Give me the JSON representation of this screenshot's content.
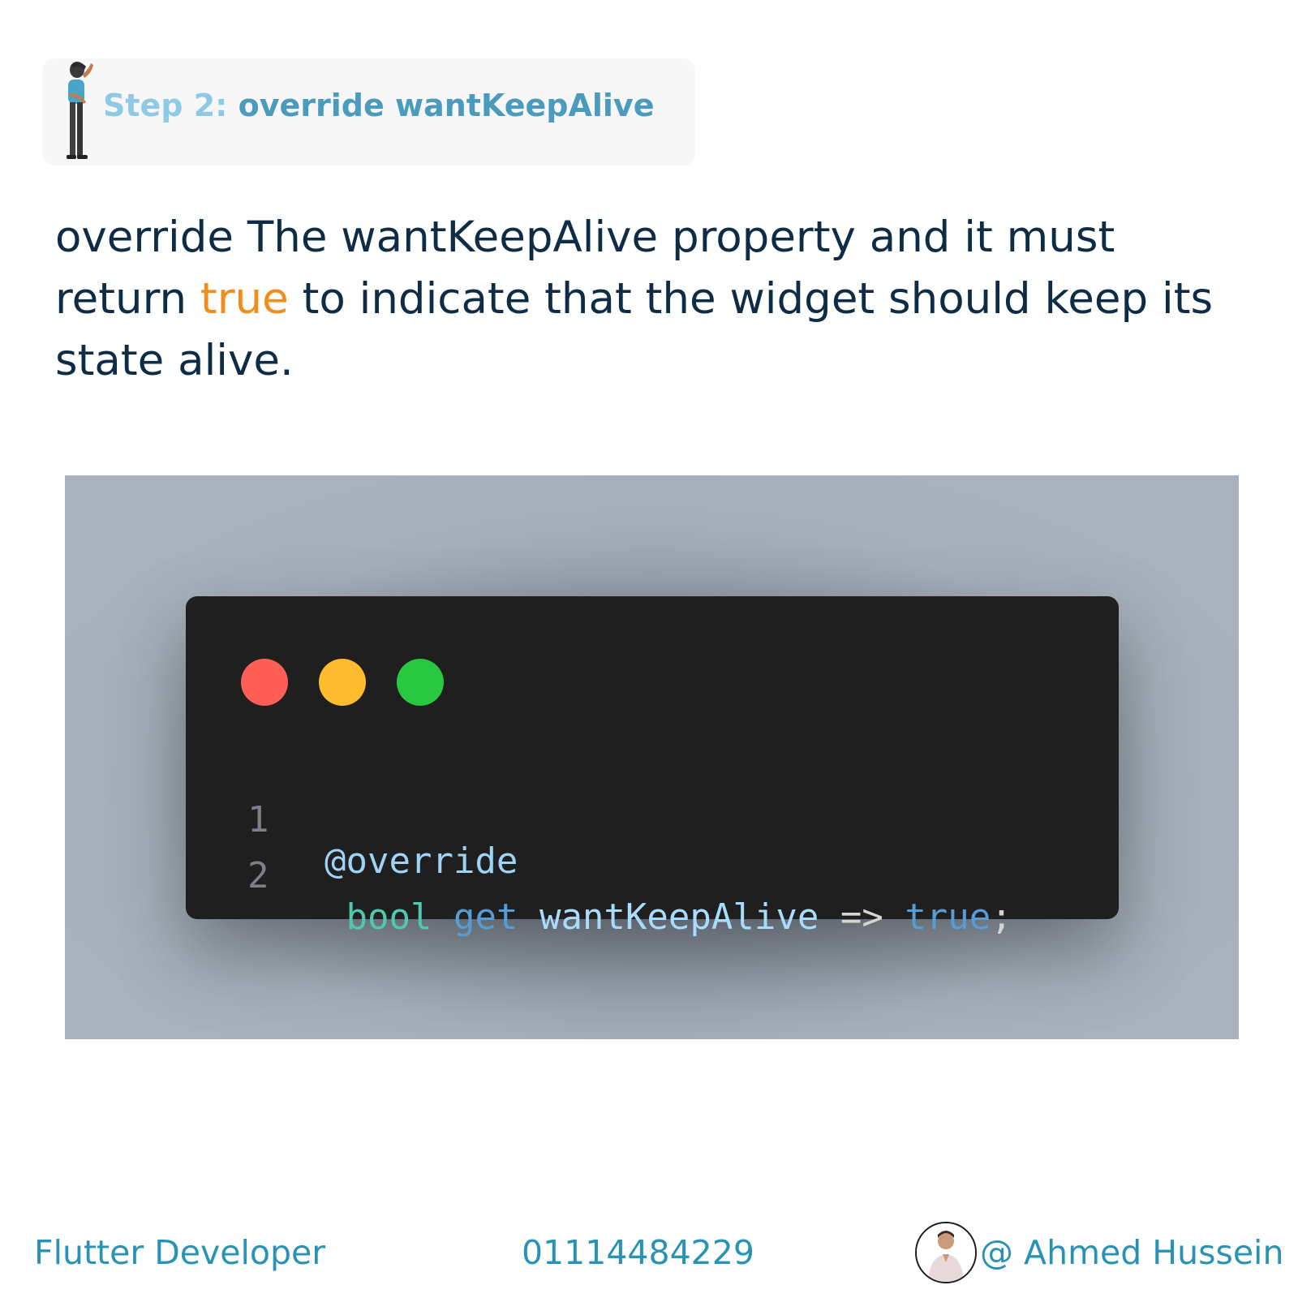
{
  "header": {
    "step_prefix": "Step 2:",
    "step_title": "override wantKeepAlive",
    "illustration_icon": "thinking-person-icon"
  },
  "description": {
    "part1": "override The wantKeepAlive property and it must return",
    "highlight": "true",
    "part2": "to indicate that the widget should keep its state alive."
  },
  "code_window": {
    "window_controls": [
      "red",
      "yellow",
      "green"
    ],
    "lines": [
      {
        "number": "1",
        "tokens": [
          "@override"
        ]
      },
      {
        "number": "2",
        "tokens": [
          "bool",
          "get",
          "wantKeepAlive",
          "=>",
          "true",
          ";"
        ]
      }
    ]
  },
  "footer": {
    "role": "Flutter Developer",
    "phone": "01114484229",
    "name": "@ Ahmed Hussein",
    "avatar_icon": "profile-avatar"
  },
  "colors": {
    "accent": "#2a93b5",
    "text_dark": "#0e2c45",
    "highlight": "#f28c1b",
    "code_bg": "#1f1f1f"
  }
}
